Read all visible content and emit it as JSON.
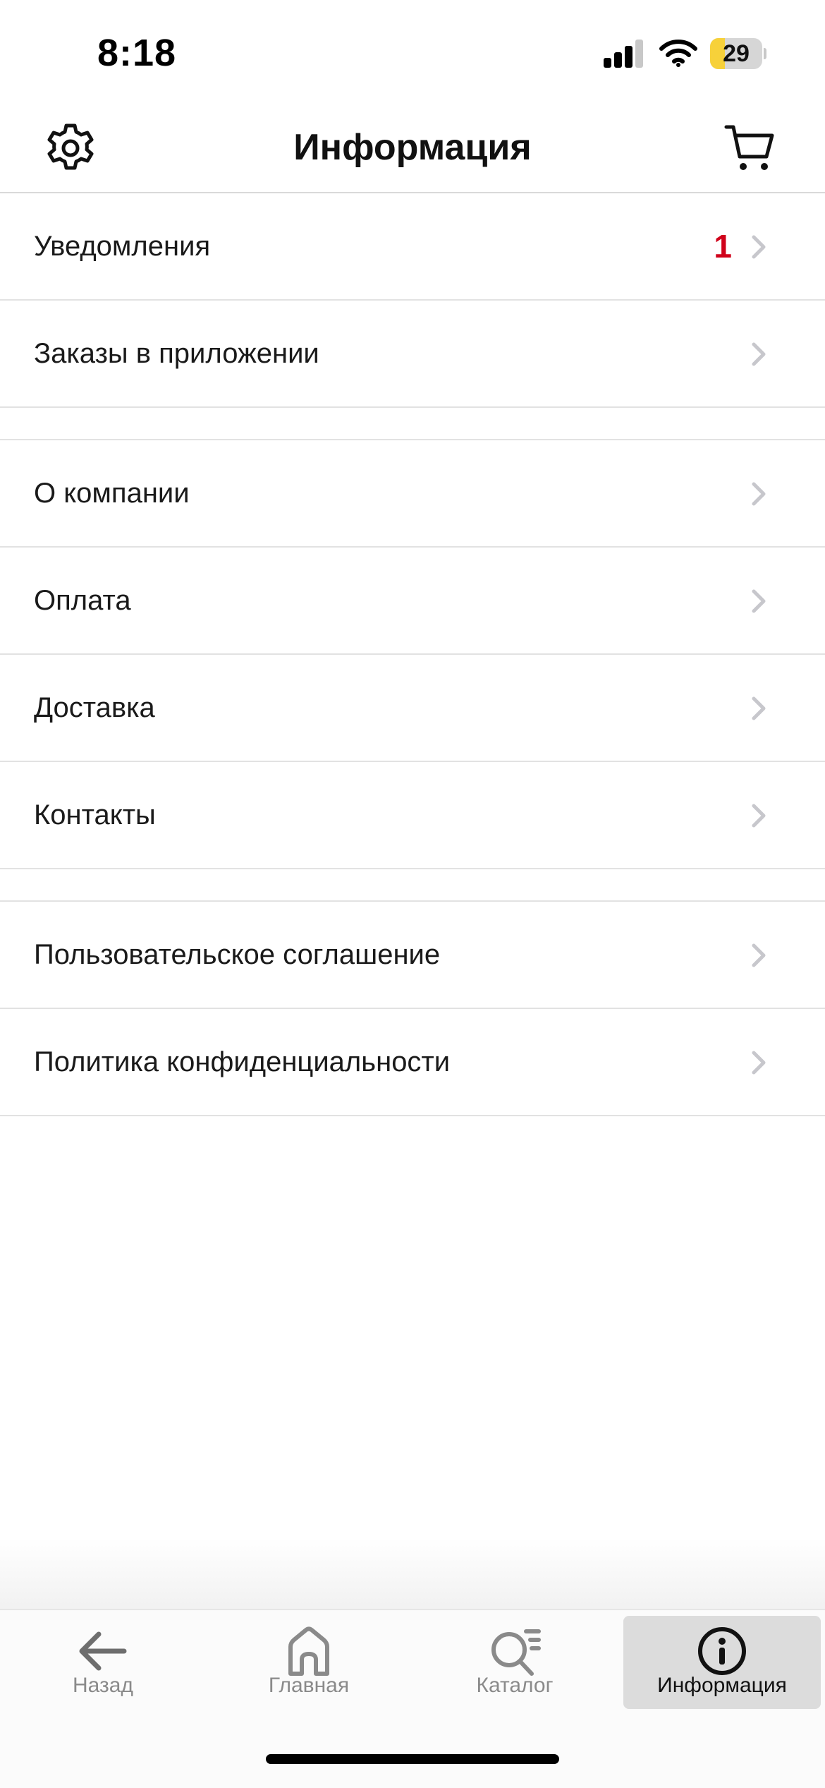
{
  "status_bar": {
    "time": "8:18",
    "battery_level": "29",
    "battery_fraction": 0.29,
    "signal_icon": "cellular-signal-icon",
    "wifi_icon": "wifi-icon"
  },
  "header": {
    "title": "Информация",
    "left_icon": "gear-icon",
    "right_icon": "cart-icon"
  },
  "menu": {
    "groups": [
      {
        "items": [
          {
            "label": "Уведомления",
            "badge": "1"
          },
          {
            "label": "Заказы в приложении"
          }
        ]
      },
      {
        "items": [
          {
            "label": "О компании"
          },
          {
            "label": "Оплата"
          },
          {
            "label": "Доставка"
          },
          {
            "label": "Контакты"
          }
        ]
      },
      {
        "items": [
          {
            "label": "Пользовательское соглашение"
          },
          {
            "label": "Политика конфиденциальности"
          }
        ]
      }
    ]
  },
  "tabbar": {
    "tabs": [
      {
        "label": "Назад",
        "icon": "arrow-left-icon"
      },
      {
        "label": "Главная",
        "icon": "home-icon"
      },
      {
        "label": "Каталог",
        "icon": "catalog-search-icon"
      },
      {
        "label": "Информация",
        "icon": "info-icon",
        "active": true
      }
    ]
  },
  "colors": {
    "badge": "#d0021b",
    "battery_fill": "#f7d13a",
    "active_tab_bg": "#dcdcdc",
    "divider": "#e2e2e2",
    "chevron": "#c7c7cc"
  }
}
